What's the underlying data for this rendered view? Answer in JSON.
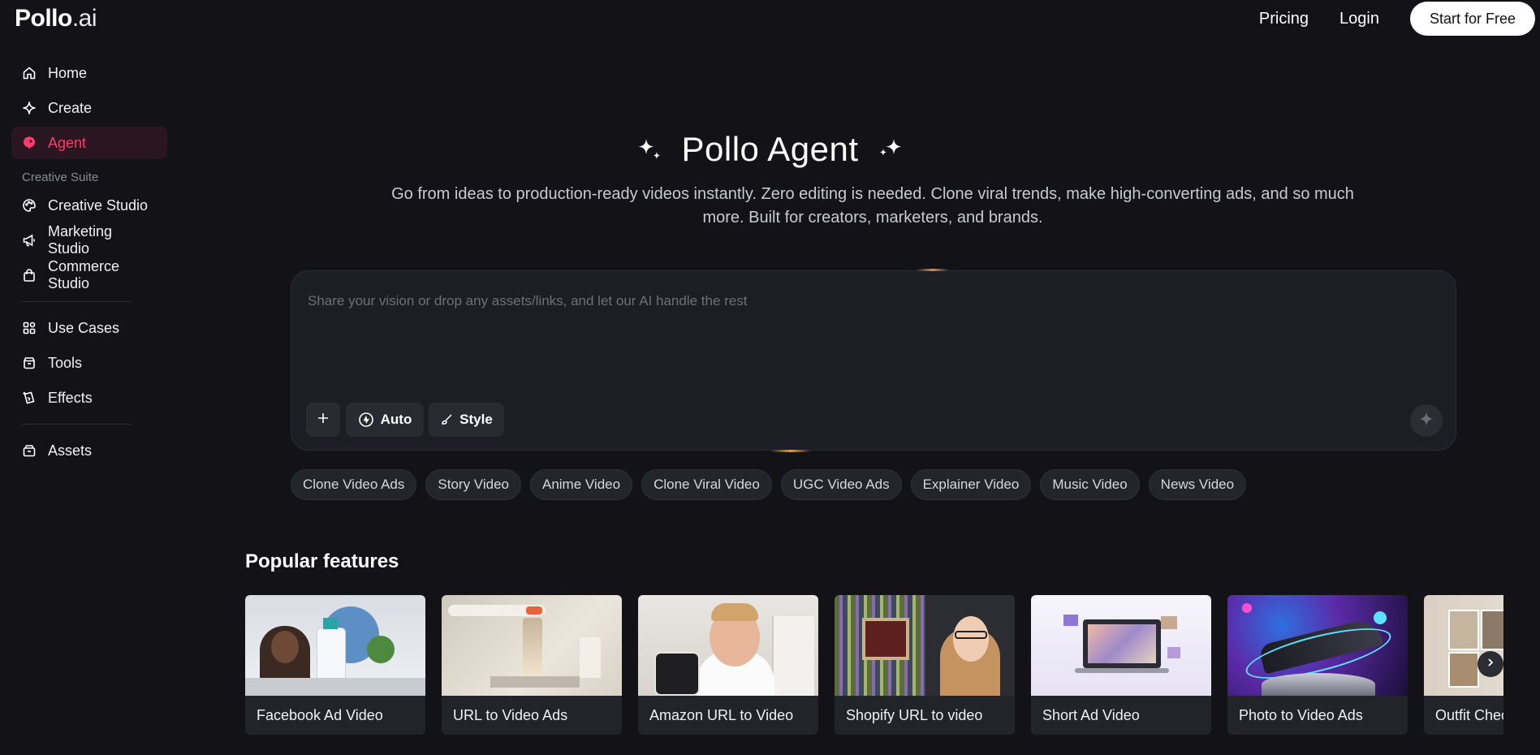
{
  "brand": {
    "name": "Pollo",
    "suffix": ".ai"
  },
  "topnav": {
    "pricing": "Pricing",
    "login": "Login",
    "cta": "Start for Free"
  },
  "sidebar": {
    "items": [
      {
        "label": "Home",
        "icon": "home-icon"
      },
      {
        "label": "Create",
        "icon": "sparkle-icon"
      },
      {
        "label": "Agent",
        "icon": "agent-icon",
        "active": true
      }
    ],
    "section_label": "Creative Suite",
    "suite": [
      {
        "label": "Creative Studio",
        "icon": "palette-icon"
      },
      {
        "label": "Marketing Studio",
        "icon": "megaphone-icon"
      },
      {
        "label": "Commerce Studio",
        "icon": "shopping-bag-icon"
      }
    ],
    "more": [
      {
        "label": "Use Cases",
        "icon": "grid-icon"
      },
      {
        "label": "Tools",
        "icon": "toolbox-icon"
      },
      {
        "label": "Effects",
        "icon": "effects-icon"
      }
    ],
    "assets": {
      "label": "Assets",
      "icon": "archive-icon"
    }
  },
  "hero": {
    "title": "Pollo Agent",
    "subtitle": "Go from ideas to production-ready videos instantly. Zero editing is needed. Clone viral trends, make high-converting ads, and so much more. Built for creators, marketers, and brands."
  },
  "prompt": {
    "placeholder": "Share your vision or drop any assets/links, and let our AI handle the rest",
    "value": "",
    "auto_label": "Auto",
    "style_label": "Style"
  },
  "chips": [
    "Clone Video Ads",
    "Story Video",
    "Anime Video",
    "Clone Viral Video",
    "UGC Video Ads",
    "Explainer Video",
    "Music Video",
    "News Video"
  ],
  "popular": {
    "title": "Popular features",
    "cards": [
      "Facebook Ad Video",
      "URL to Video Ads",
      "Amazon URL to Video",
      "Shopify URL to video",
      "Short Ad Video",
      "Photo to Video Ads",
      "Outfit Chec"
    ]
  },
  "colors": {
    "accent": "#ff3b6e",
    "background": "#121217",
    "panel": "#1d1d26"
  }
}
